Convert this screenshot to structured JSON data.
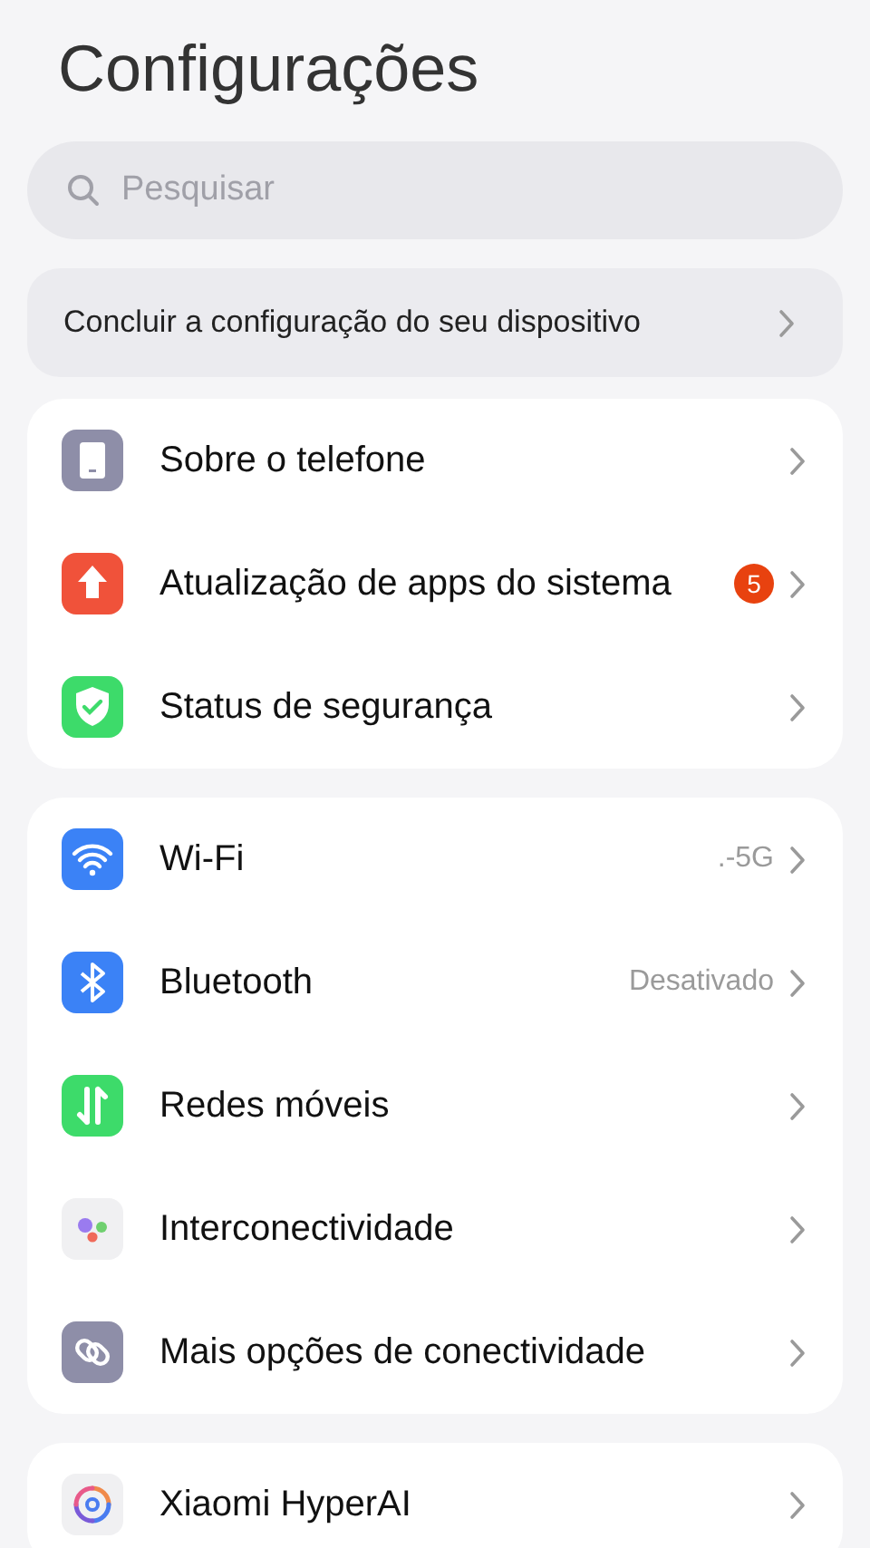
{
  "title": "Configurações",
  "search": {
    "placeholder": "Pesquisar"
  },
  "banner": {
    "label": "Concluir a configuração do seu dispositivo"
  },
  "groups": [
    {
      "items": [
        {
          "label": "Sobre o telefone"
        },
        {
          "label": "Atualização de apps do sistema",
          "badge": "5"
        },
        {
          "label": "Status de segurança"
        }
      ]
    },
    {
      "items": [
        {
          "label": "Wi-Fi",
          "value": ".-5G"
        },
        {
          "label": "Bluetooth",
          "value": "Desativado"
        },
        {
          "label": "Redes móveis"
        },
        {
          "label": "Interconectividade"
        },
        {
          "label": "Mais opções de conectividade"
        }
      ]
    },
    {
      "items": [
        {
          "label": "Xiaomi HyperAI"
        }
      ]
    }
  ]
}
